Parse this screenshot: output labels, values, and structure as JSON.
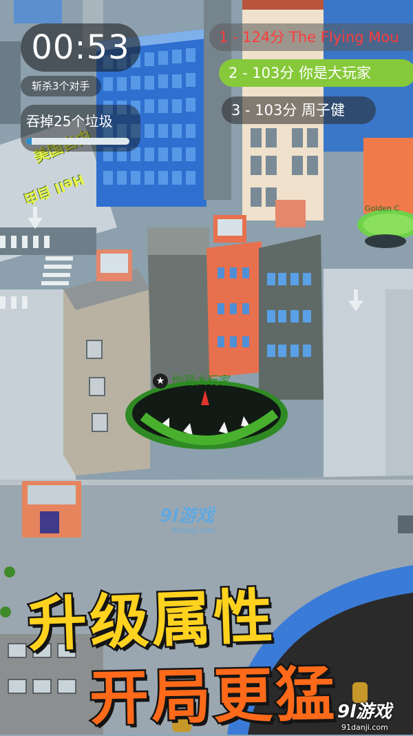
{
  "hud": {
    "timer": "00:53",
    "kills": "斩杀3个对手",
    "quest": "吞掉25个垃圾",
    "quest_progress": 0.05
  },
  "leaderboard": [
    {
      "text": "1 - 124分 The Flying Mou"
    },
    {
      "text": "2 - 103分 你是大玩家"
    },
    {
      "text": "3 - 103分 周子健"
    }
  ],
  "player_label": "你是大玩家",
  "golden_label": "Golden C",
  "map_decals": [
    "美国自由",
    "Hell 自由"
  ],
  "watermark_mid": {
    "brand": "9l游戏",
    "site": "91danji.com"
  },
  "promo": {
    "line1": "升级属性",
    "line2": "开局更猛"
  },
  "watermark_corner": {
    "brand": "9l游戏",
    "site": "91danji.com"
  },
  "colors": {
    "leader_first": "#ff3b3b",
    "leader_player": "#86c93a",
    "promo_yellow": "#ffd21f",
    "promo_orange": "#ff6a1a",
    "hole_rim": "#3fa12e"
  }
}
